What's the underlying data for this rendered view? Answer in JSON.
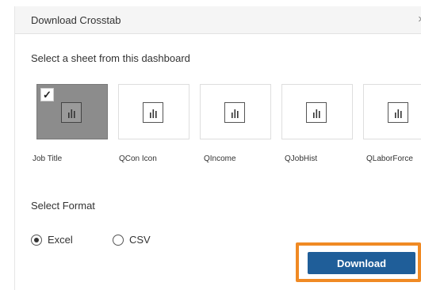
{
  "dialog": {
    "title": "Download Crosstab",
    "close_icon": "×"
  },
  "sheets": {
    "prompt": "Select a sheet from this dashboard",
    "items": [
      {
        "label": "Job Title",
        "selected": true,
        "icon": "bar-chart-icon"
      },
      {
        "label": "QCon Icon",
        "selected": false,
        "icon": "bar-chart-icon"
      },
      {
        "label": "QIncome",
        "selected": false,
        "icon": "bar-chart-icon"
      },
      {
        "label": "QJobHist",
        "selected": false,
        "icon": "bar-chart-icon"
      },
      {
        "label": "QLaborForce",
        "selected": false,
        "icon": "bar-chart-icon"
      }
    ],
    "check_mark": "✓"
  },
  "format": {
    "label": "Select Format",
    "options": [
      {
        "label": "Excel",
        "selected": true
      },
      {
        "label": "CSV",
        "selected": false
      }
    ]
  },
  "actions": {
    "download_label": "Download"
  },
  "colors": {
    "primary_button": "#1f5e99",
    "highlight": "#f08a24",
    "selected_tile": "#8c8c8c"
  }
}
